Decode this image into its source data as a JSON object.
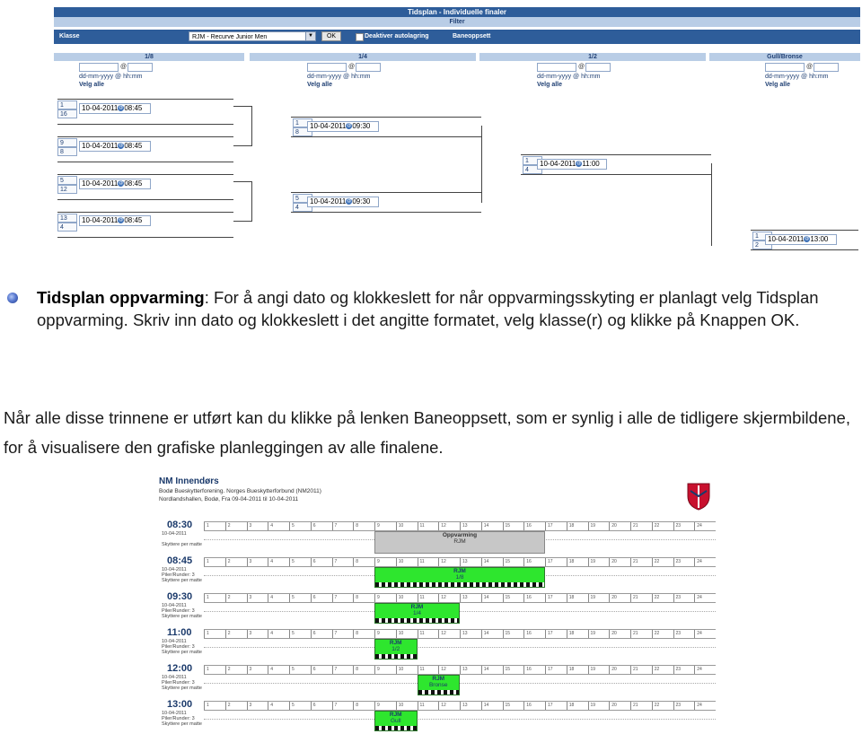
{
  "bracket": {
    "title": "Tidsplan - Individuelle finaler",
    "filter_label": "Filter",
    "klasse_label": "Klasse",
    "klasse_value": "RJM - Recurve Junior Men",
    "ok_label": "OK",
    "deactivate_label": "Deaktiver autolagring",
    "baneoppsett_label": "Baneoppsett",
    "rounds": [
      {
        "label": "1/8",
        "at": "@",
        "format": "dd-mm-yyyy @ hh:mm",
        "select_all": "Velg alle"
      },
      {
        "label": "1/4",
        "at": "@",
        "format": "dd-mm-yyyy @ hh:mm",
        "select_all": "Velg alle"
      },
      {
        "label": "1/2",
        "at": "@",
        "format": "dd-mm-yyyy @ hh:mm",
        "select_all": "Velg alle"
      },
      {
        "label": "Gull/Bronse",
        "at": "@",
        "format": "dd-mm-yyyy @ hh:mm",
        "select_all": "Velg alle"
      }
    ],
    "matches": [
      {
        "s1": "1",
        "s2": "16",
        "date": "10-04-2011",
        "time": "08:45"
      },
      {
        "s1": "9",
        "s2": "8",
        "date": "10-04-2011",
        "time": "08:45"
      },
      {
        "s1": "5",
        "s2": "12",
        "date": "10-04-2011",
        "time": "08:45"
      },
      {
        "s1": "13",
        "s2": "4",
        "date": "10-04-2011",
        "time": "08:45"
      },
      {
        "s1": "1",
        "s2": "8",
        "date": "10-04-2011",
        "time": "09:30"
      },
      {
        "s1": "5",
        "s2": "4",
        "date": "10-04-2011",
        "time": "09:30"
      },
      {
        "s1": "1",
        "s2": "4",
        "date": "10-04-2011",
        "time": "11:00"
      },
      {
        "s1": "1",
        "s2": "2",
        "date": "10-04-2011",
        "time": "13:00"
      }
    ]
  },
  "bullet": {
    "bold": "Tidsplan oppvarming",
    "rest": ": For å angi dato og klokkeslett for når oppvarmingsskyting er planlagt velg Tidsplan oppvarming. Skriv inn dato og klokkeslett i det angitte formatet, velg klasse(r) og klikke på Knappen OK."
  },
  "paragraph": "Når alle disse trinnene er utført kan du klikke på lenken Baneoppsett, som er synlig i alle de tidligere skjermbildene, for å visualisere den grafiske planleggingen av alle finalene.",
  "schedule": {
    "title": "NM Innendørs",
    "line1": "Bodø Bueskytterforening. Norges Bueskytterforbund (NM2011)",
    "line2": "Nordlandshallen, Bodø, Fra 09-04-2011 til 10-04-2011",
    "targets": [
      "1",
      "2",
      "3",
      "4",
      "5",
      "6",
      "7",
      "8",
      "9",
      "10",
      "11",
      "12",
      "13",
      "14",
      "15",
      "16",
      "17",
      "18",
      "19",
      "20",
      "21",
      "22",
      "23",
      "24"
    ],
    "rows": [
      {
        "time": "08:30",
        "date": "10-04-2011",
        "arrows": "",
        "note": "Skyttere per matte",
        "block_title": "Oppvarming",
        "block_sub": "RJM",
        "kind": "grey",
        "start": 9,
        "span": 8
      },
      {
        "time": "08:45",
        "date": "10-04-2011",
        "arrows": "Piler/Runder: 3",
        "note": "Skyttere per matte",
        "block_title": "RJM",
        "block_sub": "1/8",
        "kind": "green",
        "start": 9,
        "span": 8
      },
      {
        "time": "09:30",
        "date": "10-04-2011",
        "arrows": "Piler/Runder: 3",
        "note": "Skyttere per matte",
        "block_title": "RJM",
        "block_sub": "1/4",
        "kind": "green",
        "start": 9,
        "span": 4
      },
      {
        "time": "11:00",
        "date": "10-04-2011",
        "arrows": "Piler/Runder: 3",
        "note": "Skyttere per matte",
        "block_title": "RJM",
        "block_sub": "1/2",
        "kind": "green",
        "start": 9,
        "span": 2
      },
      {
        "time": "12:00",
        "date": "10-04-2011",
        "arrows": "Piler/Runder: 3",
        "note": "Skyttere per matte",
        "block_title": "RJM",
        "block_sub": "Bronse",
        "kind": "green",
        "start": 11,
        "span": 2
      },
      {
        "time": "13:00",
        "date": "10-04-2011",
        "arrows": "Piler/Runder: 3",
        "note": "Skyttere per matte",
        "block_title": "RJM",
        "block_sub": "Gull",
        "kind": "green",
        "start": 9,
        "span": 2
      }
    ]
  }
}
